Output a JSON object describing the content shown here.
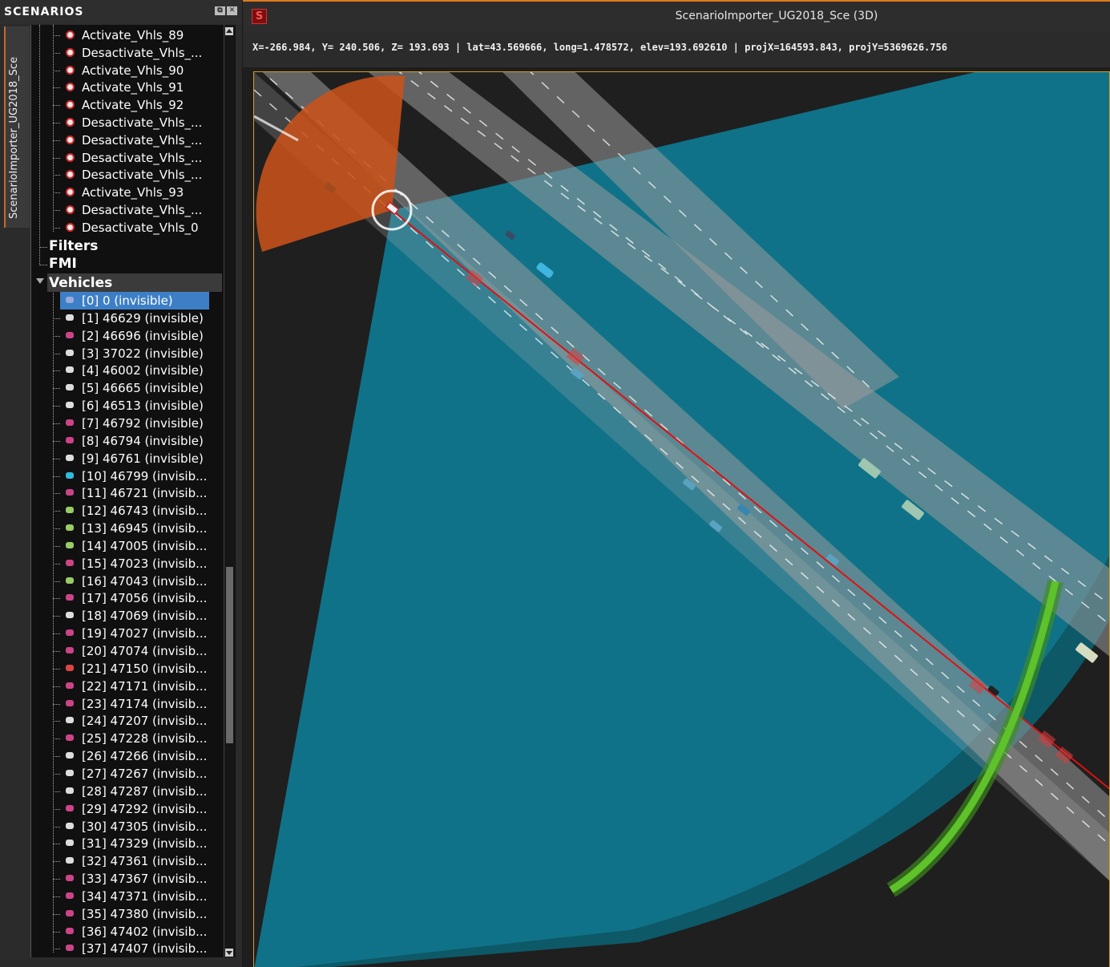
{
  "panel": {
    "title": "SCENARIOS",
    "vertical_tab": "ScenarioImporter_UG2018_Sce",
    "float_button": "⧉",
    "close_button": "✕"
  },
  "tree": {
    "subscenarios": [
      "Activate_Vhls_89",
      "Desactivate_Vhls_...",
      "Activate_Vhls_90",
      "Activate_Vhls_91",
      "Activate_Vhls_92",
      "Desactivate_Vhls_...",
      "Desactivate_Vhls_...",
      "Desactivate_Vhls_...",
      "Desactivate_Vhls_...",
      "Activate_Vhls_93",
      "Desactivate_Vhls_...",
      "Desactivate_Vhls_0"
    ],
    "sections": {
      "filters": "Filters",
      "fmi": "FMI",
      "vehicles": "Vehicles"
    },
    "vehicles": [
      "[0] 0 (invisible)",
      "[1] 46629 (invisible)",
      "[2] 46696 (invisible)",
      "[3] 37022 (invisible)",
      "[4] 46002 (invisible)",
      "[5] 46665 (invisible)",
      "[6] 46513 (invisible)",
      "[7] 46792 (invisible)",
      "[8] 46794 (invisible)",
      "[9] 46761 (invisible)",
      "[10] 46799 (invisib...",
      "[11] 46721 (invisib...",
      "[12] 46743 (invisib...",
      "[13] 46945 (invisib...",
      "[14] 47005 (invisib...",
      "[15] 47023 (invisib...",
      "[16] 47043 (invisib...",
      "[17] 47056 (invisib...",
      "[18] 47069 (invisib...",
      "[19] 47027 (invisib...",
      "[20] 47074 (invisib...",
      "[21] 47150 (invisib...",
      "[22] 47171 (invisib...",
      "[23] 47174 (invisib...",
      "[24] 47207 (invisib...",
      "[25] 47228 (invisib...",
      "[26] 47266 (invisib...",
      "[27] 47267 (invisib...",
      "[28] 47287 (invisib...",
      "[29] 47292 (invisib...",
      "[30] 47305 (invisib...",
      "[31] 47329 (invisib...",
      "[32] 47361 (invisib...",
      "[33] 47367 (invisib...",
      "[34] 47371 (invisib...",
      "[35] 47380 (invisib...",
      "[36] 47402 (invisib...",
      "[37] 47407 (invisib..."
    ],
    "selected_vehicle_index": 0
  },
  "viewport": {
    "logo": "S",
    "title": "ScenarioImporter_UG2018_Sce (3D)",
    "coordinates": "X=-266.984, Y= 240.506, Z= 193.693 | lat=43.569666, long=1.478572, elev=193.692610 | projX=164593.843, projY=5369626.756"
  },
  "colors": {
    "accent_orange": "#e07a1e",
    "selection_blue": "#3d7fc6",
    "sensor_cyan": "#0f7288",
    "sensor_orange": "#c9521a",
    "route_red": "#e01010",
    "arc_green": "#5ec22a",
    "road_gray": "#8a8a8a"
  },
  "icons": {
    "subscenario": "scenario-pin-icon",
    "vehicle": "vehicle-icon",
    "expand": "expand-arrow-icon"
  }
}
